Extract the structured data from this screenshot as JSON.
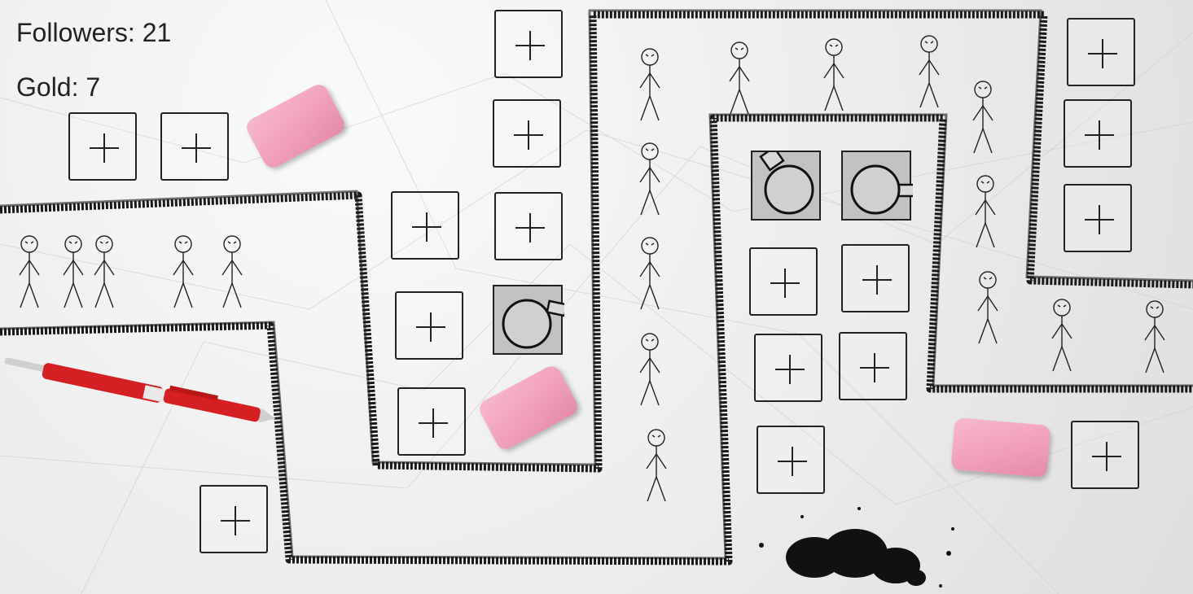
{
  "hud": {
    "followers_label": "Followers: 21",
    "gold_label": "Gold: 7"
  },
  "game": {
    "empty_slot_icon": "plus-icon",
    "tower_icon": "coffee-mug-icon",
    "enemy_icon": "stickman-icon",
    "obstacle_icon": "eraser-icon",
    "decoration_icons": [
      "red-pen-icon",
      "ink-splat-icon"
    ],
    "colors": {
      "path": "#1a1a1a",
      "eraser": "#f0a3c0",
      "tower_bg": "#c2c2c2",
      "pen": "#d42020",
      "paper": "#ececec"
    }
  }
}
